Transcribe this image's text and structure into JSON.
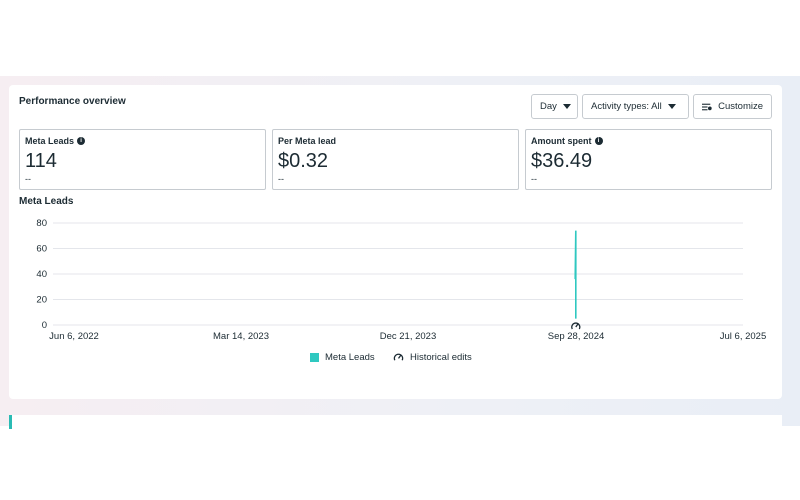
{
  "panel": {
    "title": "Performance overview",
    "controls": {
      "day_label": "Day",
      "activity_label": "Activity types: All",
      "customize_label": "Customize"
    }
  },
  "metrics": [
    {
      "label": "Meta Leads",
      "value": "114",
      "sub": "--",
      "has_info": true
    },
    {
      "label": "Per Meta lead",
      "value": "$0.32",
      "sub": "--",
      "has_info": false
    },
    {
      "label": "Amount spent",
      "value": "$36.49",
      "sub": "--",
      "has_info": true
    }
  ],
  "chart_data": {
    "type": "line",
    "title": "Meta Leads",
    "x_ticks": [
      "Jun 6, 2022",
      "Mar 14, 2023",
      "Dec 21, 2023",
      "Sep 28, 2024",
      "Jul 6, 2025"
    ],
    "xlim": [
      "2022-06-06",
      "2025-07-06"
    ],
    "y_ticks": [
      0,
      20,
      40,
      60,
      80
    ],
    "ylim": [
      0,
      80
    ],
    "grid": true,
    "series": [
      {
        "name": "Meta Leads",
        "color": "#2fc8c0",
        "points": [
          {
            "x": "2024-09-27",
            "y": 36
          },
          {
            "x": "2024-09-28",
            "y": 74
          },
          {
            "x": "2024-09-28",
            "y": 5
          }
        ]
      }
    ],
    "historical_edit_markers": [
      "2024-09-28"
    ],
    "legend": {
      "position": "bottom-center",
      "items": [
        "Meta Leads",
        "Historical edits"
      ]
    }
  },
  "icons": {
    "edit_marker": "gauge-icon",
    "customize": "sliders-icon",
    "info": "info-icon"
  }
}
